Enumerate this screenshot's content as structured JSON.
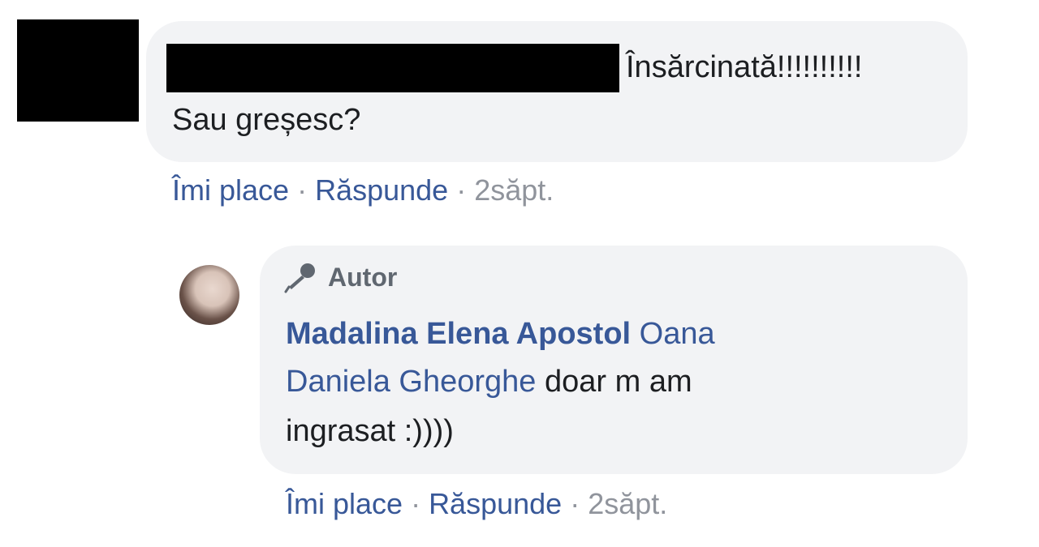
{
  "comment": {
    "text_line1": "Însărcinată!!!!!!!!!!",
    "text_line2": "Sau greșesc?",
    "actions": {
      "like": "Îmi place",
      "reply": "Răspunde",
      "time": "2săpt."
    }
  },
  "reply": {
    "badge": "Autor",
    "author": "Madalina Elena Apostol",
    "mention_line1": "Oana",
    "mention_line2": "Daniela Gheorghe",
    "text_line2": "doar m am",
    "text_line3": "ingrasat :))))",
    "actions": {
      "like": "Îmi place",
      "reply": "Răspunde",
      "time": "2săpt."
    }
  },
  "separator": "·",
  "colors": {
    "link": "#385898",
    "muted": "#90949c",
    "bubble": "#f2f3f5",
    "text": "#1c1e21"
  }
}
